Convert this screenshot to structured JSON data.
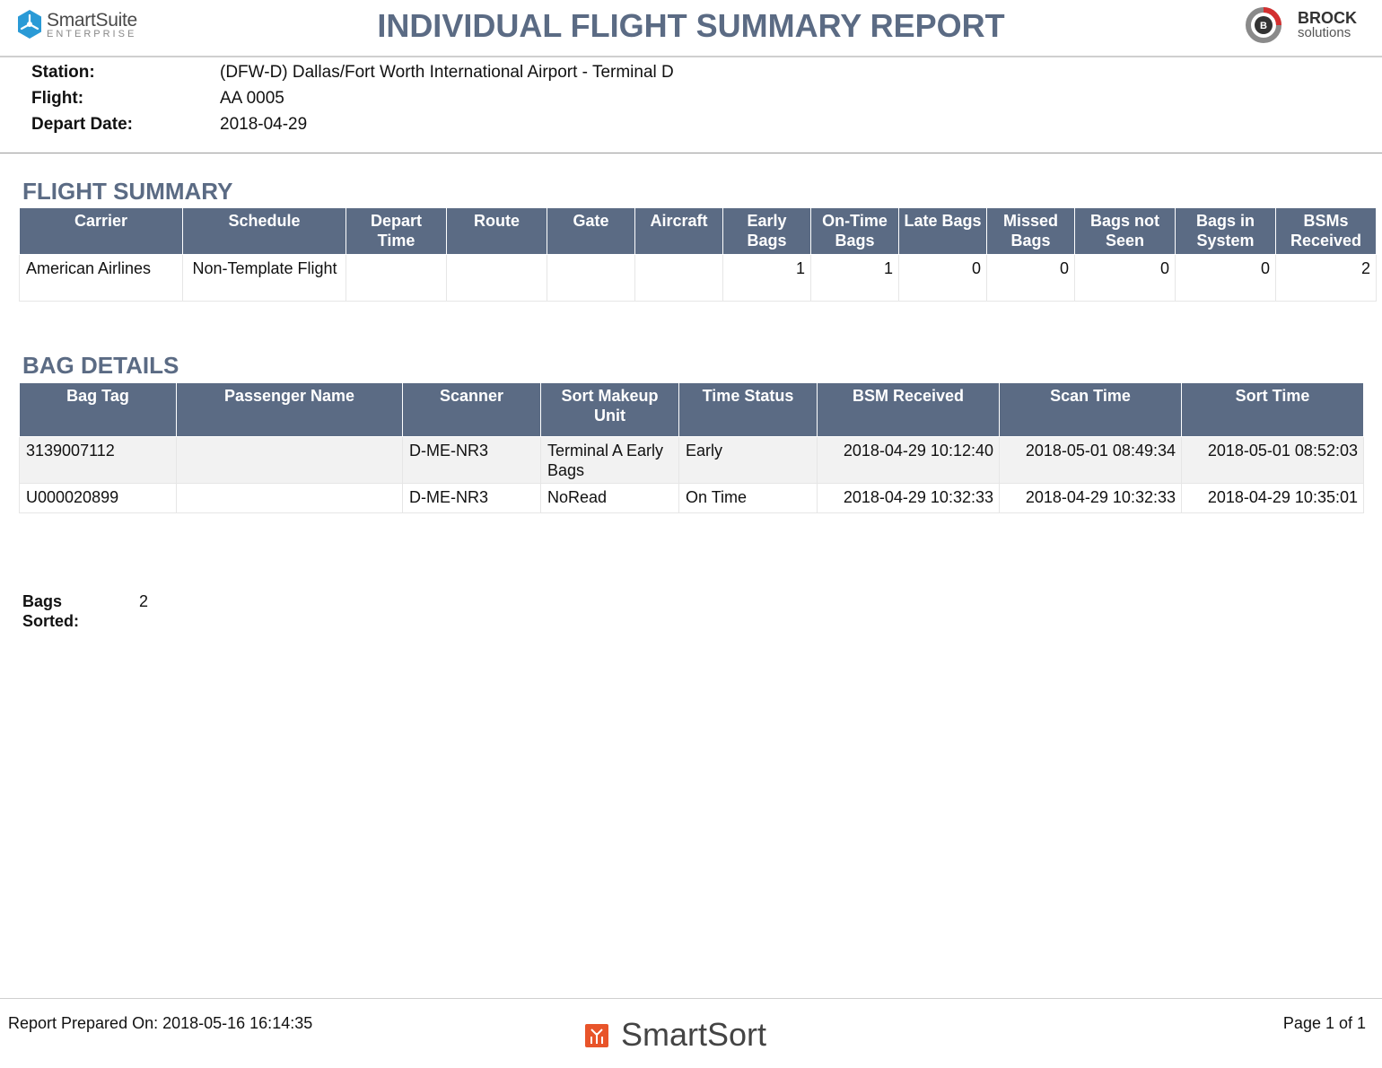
{
  "header": {
    "left_logo": {
      "brand": "SmartSuite",
      "sub": "ENTERPRISE",
      "icon": "hexagon-propeller-icon",
      "color": "#2a9ad6"
    },
    "title": "INDIVIDUAL FLIGHT SUMMARY REPORT",
    "right_logo": {
      "name": "BROCK",
      "sub": "solutions",
      "icon": "brock-ring-icon",
      "color": "#d32f2f"
    }
  },
  "meta": {
    "station_label": "Station:",
    "station": "(DFW-D) Dallas/Fort Worth International Airport - Terminal D",
    "flight_label": "Flight:",
    "flight": "AA 0005",
    "depart_date_label": "Depart Date:",
    "depart_date": "2018-04-29"
  },
  "flight_summary": {
    "title": "FLIGHT SUMMARY",
    "headers": [
      "Carrier",
      "Schedule",
      "Depart Time",
      "Route",
      "Gate",
      "Aircraft",
      "Early Bags",
      "On-Time Bags",
      "Late Bags",
      "Missed Bags",
      "Bags not Seen",
      "Bags in System",
      "BSMs Received"
    ],
    "rows": [
      [
        "American Airlines",
        "Non-Template Flight",
        "",
        "",
        "",
        "",
        "1",
        "1",
        "0",
        "0",
        "0",
        "0",
        "2"
      ]
    ]
  },
  "bag_details": {
    "title": "BAG DETAILS",
    "headers": [
      "Bag Tag",
      "Passenger Name",
      "Scanner",
      "Sort Makeup Unit",
      "Time Status",
      "BSM Received",
      "Scan Time",
      "Sort Time"
    ],
    "rows": [
      [
        "3139007112",
        "",
        "D-ME-NR3",
        "Terminal A Early Bags",
        "Early",
        "2018-04-29 10:12:40",
        "2018-05-01 08:49:34",
        "2018-05-01 08:52:03"
      ],
      [
        "U000020899",
        "",
        "D-ME-NR3",
        "NoRead",
        "On Time",
        "2018-04-29 10:32:33",
        "2018-04-29 10:32:33",
        "2018-04-29 10:35:01"
      ]
    ]
  },
  "totals": {
    "bags_sorted_label": "Bags Sorted:",
    "bags_sorted": "2"
  },
  "footer": {
    "prepared": "Report Prepared On: 2018-05-16 16:14:35",
    "product": "SmartSort",
    "product_icon": "smartsort-icon",
    "page": "Page 1 of 1"
  },
  "colors": {
    "header_bg": "#5b6b84",
    "title": "#5b6b84",
    "accent_orange": "#e8542a"
  }
}
